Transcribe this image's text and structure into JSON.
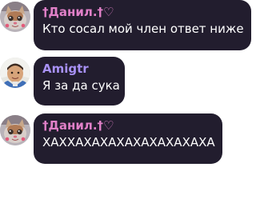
{
  "colors": {
    "bubble_bg": "#221d2e",
    "message_text": "#ffffff",
    "user_pink": "#e080c8",
    "user_purple": "#a891f5"
  },
  "messages": [
    {
      "username": "†Данил.†♡",
      "text": "Кто сосал мой член ответ ниже",
      "avatar_icon": "cat-face-avatar",
      "username_color": "#e080c8"
    },
    {
      "username": "Amigtr",
      "text": "Я за да сука",
      "avatar_icon": "person-photo-avatar",
      "username_color": "#a891f5"
    },
    {
      "username": "†Данил.†♡",
      "text": "ХАХХАХАХАХАХАХАХАХАХА",
      "avatar_icon": "cat-face-avatar",
      "username_color": "#e080c8"
    }
  ]
}
